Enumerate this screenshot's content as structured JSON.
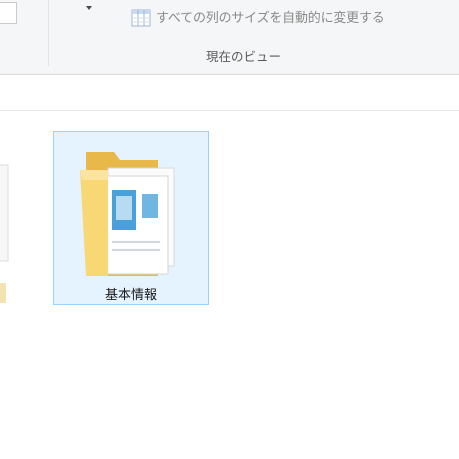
{
  "ribbon": {
    "autosize_columns_label": "すべての列のサイズを自動的に変更する",
    "group_label": "現在のビュー"
  },
  "content": {
    "items": [
      {
        "name": "基本情報",
        "type": "folder",
        "selected": true
      }
    ]
  },
  "colors": {
    "selection_fill": "#e5f3ff",
    "selection_border": "#99d1ff",
    "folder_yellow": "#f8d775",
    "ribbon_bg": "#f5f6f7"
  },
  "icons": {
    "autosize": "autosize-columns-icon",
    "folder": "folder-with-documents-icon",
    "dropdown": "chevron-down-icon"
  }
}
